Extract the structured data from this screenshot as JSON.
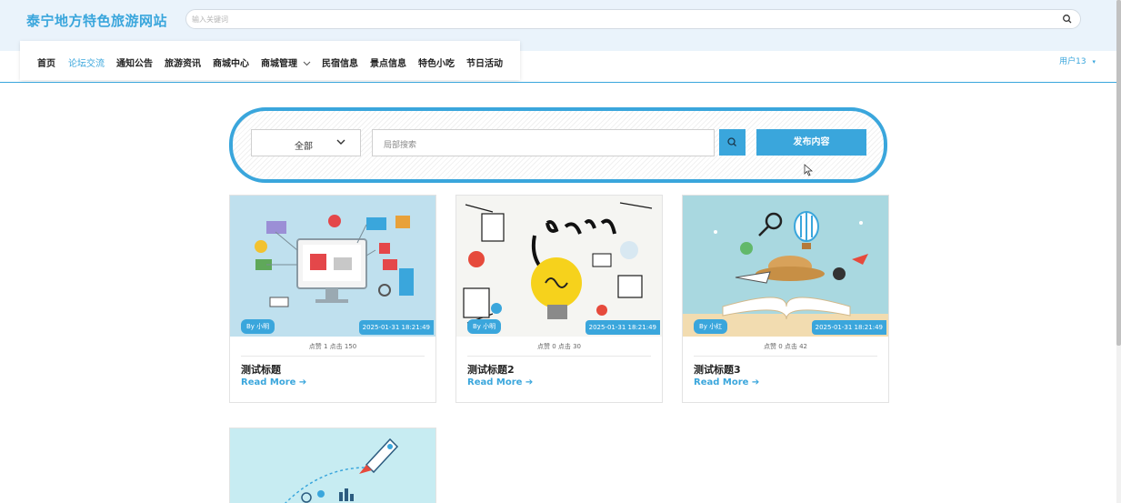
{
  "header": {
    "site_title": "泰宁地方特色旅游网站",
    "search_placeholder": "输入关键词"
  },
  "nav": {
    "items": [
      {
        "label": "首页"
      },
      {
        "label": "论坛交流"
      },
      {
        "label": "通知公告"
      },
      {
        "label": "旅游资讯"
      },
      {
        "label": "商城中心"
      },
      {
        "label": "商城管理"
      },
      {
        "label": "民宿信息"
      },
      {
        "label": "景点信息"
      },
      {
        "label": "特色小吃"
      },
      {
        "label": "节日活动"
      }
    ],
    "active_index": 1,
    "user_label": "用户13"
  },
  "filter": {
    "category_value": "全部",
    "search_placeholder": "局部搜索",
    "publish_label": "发布内容"
  },
  "cards": [
    {
      "author": "By 小明",
      "date": "2025-01-31 18:21:49",
      "stats": "点赞 1  点击 150",
      "title": "测试标题",
      "read_more": "Read More"
    },
    {
      "author": "By 小明",
      "date": "2025-01-31 18:21:49",
      "stats": "点赞 0  点击 30",
      "title": "测试标题2",
      "read_more": "Read More"
    },
    {
      "author": "By 小红",
      "date": "2025-01-31 18:21:49",
      "stats": "点赞 0  点击 42",
      "title": "测试标题3",
      "read_more": "Read More"
    }
  ],
  "colors": {
    "accent": "#3aa6dc",
    "header_bg": "#eaf3fb"
  }
}
